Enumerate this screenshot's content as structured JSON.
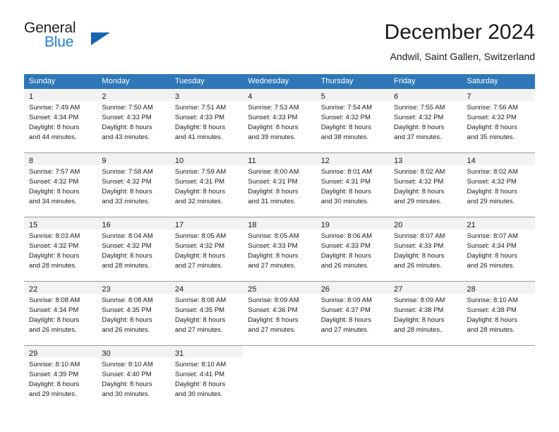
{
  "brand": {
    "name_top": "General",
    "name_bottom": "Blue",
    "triangle_icon": "triangle-icon",
    "color_dark": "#231f20",
    "color_blue": "#1f7fd4"
  },
  "header": {
    "title": "December 2024",
    "subtitle": "Andwil, Saint Gallen, Switzerland"
  },
  "theme": {
    "header_bg": "#2f77b8",
    "header_text": "#ffffff",
    "daynum_band_bg": "#f2f2f2",
    "grid_line": "#9a9a9a",
    "page_bg": "#ffffff"
  },
  "calendar": {
    "weekday_headers": [
      "Sunday",
      "Monday",
      "Tuesday",
      "Wednesday",
      "Thursday",
      "Friday",
      "Saturday"
    ],
    "weeks": [
      [
        {
          "day": "1",
          "sunrise": "Sunrise: 7:49 AM",
          "sunset": "Sunset: 4:34 PM",
          "daylight1": "Daylight: 8 hours",
          "daylight2": "and 44 minutes."
        },
        {
          "day": "2",
          "sunrise": "Sunrise: 7:50 AM",
          "sunset": "Sunset: 4:33 PM",
          "daylight1": "Daylight: 8 hours",
          "daylight2": "and 43 minutes."
        },
        {
          "day": "3",
          "sunrise": "Sunrise: 7:51 AM",
          "sunset": "Sunset: 4:33 PM",
          "daylight1": "Daylight: 8 hours",
          "daylight2": "and 41 minutes."
        },
        {
          "day": "4",
          "sunrise": "Sunrise: 7:53 AM",
          "sunset": "Sunset: 4:33 PM",
          "daylight1": "Daylight: 8 hours",
          "daylight2": "and 39 minutes."
        },
        {
          "day": "5",
          "sunrise": "Sunrise: 7:54 AM",
          "sunset": "Sunset: 4:32 PM",
          "daylight1": "Daylight: 8 hours",
          "daylight2": "and 38 minutes."
        },
        {
          "day": "6",
          "sunrise": "Sunrise: 7:55 AM",
          "sunset": "Sunset: 4:32 PM",
          "daylight1": "Daylight: 8 hours",
          "daylight2": "and 37 minutes."
        },
        {
          "day": "7",
          "sunrise": "Sunrise: 7:56 AM",
          "sunset": "Sunset: 4:32 PM",
          "daylight1": "Daylight: 8 hours",
          "daylight2": "and 35 minutes."
        }
      ],
      [
        {
          "day": "8",
          "sunrise": "Sunrise: 7:57 AM",
          "sunset": "Sunset: 4:32 PM",
          "daylight1": "Daylight: 8 hours",
          "daylight2": "and 34 minutes."
        },
        {
          "day": "9",
          "sunrise": "Sunrise: 7:58 AM",
          "sunset": "Sunset: 4:32 PM",
          "daylight1": "Daylight: 8 hours",
          "daylight2": "and 33 minutes."
        },
        {
          "day": "10",
          "sunrise": "Sunrise: 7:59 AM",
          "sunset": "Sunset: 4:31 PM",
          "daylight1": "Daylight: 8 hours",
          "daylight2": "and 32 minutes."
        },
        {
          "day": "11",
          "sunrise": "Sunrise: 8:00 AM",
          "sunset": "Sunset: 4:31 PM",
          "daylight1": "Daylight: 8 hours",
          "daylight2": "and 31 minutes."
        },
        {
          "day": "12",
          "sunrise": "Sunrise: 8:01 AM",
          "sunset": "Sunset: 4:31 PM",
          "daylight1": "Daylight: 8 hours",
          "daylight2": "and 30 minutes."
        },
        {
          "day": "13",
          "sunrise": "Sunrise: 8:02 AM",
          "sunset": "Sunset: 4:32 PM",
          "daylight1": "Daylight: 8 hours",
          "daylight2": "and 29 minutes."
        },
        {
          "day": "14",
          "sunrise": "Sunrise: 8:02 AM",
          "sunset": "Sunset: 4:32 PM",
          "daylight1": "Daylight: 8 hours",
          "daylight2": "and 29 minutes."
        }
      ],
      [
        {
          "day": "15",
          "sunrise": "Sunrise: 8:03 AM",
          "sunset": "Sunset: 4:32 PM",
          "daylight1": "Daylight: 8 hours",
          "daylight2": "and 28 minutes."
        },
        {
          "day": "16",
          "sunrise": "Sunrise: 8:04 AM",
          "sunset": "Sunset: 4:32 PM",
          "daylight1": "Daylight: 8 hours",
          "daylight2": "and 28 minutes."
        },
        {
          "day": "17",
          "sunrise": "Sunrise: 8:05 AM",
          "sunset": "Sunset: 4:32 PM",
          "daylight1": "Daylight: 8 hours",
          "daylight2": "and 27 minutes."
        },
        {
          "day": "18",
          "sunrise": "Sunrise: 8:05 AM",
          "sunset": "Sunset: 4:33 PM",
          "daylight1": "Daylight: 8 hours",
          "daylight2": "and 27 minutes."
        },
        {
          "day": "19",
          "sunrise": "Sunrise: 8:06 AM",
          "sunset": "Sunset: 4:33 PM",
          "daylight1": "Daylight: 8 hours",
          "daylight2": "and 26 minutes."
        },
        {
          "day": "20",
          "sunrise": "Sunrise: 8:07 AM",
          "sunset": "Sunset: 4:33 PM",
          "daylight1": "Daylight: 8 hours",
          "daylight2": "and 26 minutes."
        },
        {
          "day": "21",
          "sunrise": "Sunrise: 8:07 AM",
          "sunset": "Sunset: 4:34 PM",
          "daylight1": "Daylight: 8 hours",
          "daylight2": "and 26 minutes."
        }
      ],
      [
        {
          "day": "22",
          "sunrise": "Sunrise: 8:08 AM",
          "sunset": "Sunset: 4:34 PM",
          "daylight1": "Daylight: 8 hours",
          "daylight2": "and 26 minutes."
        },
        {
          "day": "23",
          "sunrise": "Sunrise: 8:08 AM",
          "sunset": "Sunset: 4:35 PM",
          "daylight1": "Daylight: 8 hours",
          "daylight2": "and 26 minutes."
        },
        {
          "day": "24",
          "sunrise": "Sunrise: 8:08 AM",
          "sunset": "Sunset: 4:35 PM",
          "daylight1": "Daylight: 8 hours",
          "daylight2": "and 27 minutes."
        },
        {
          "day": "25",
          "sunrise": "Sunrise: 8:09 AM",
          "sunset": "Sunset: 4:36 PM",
          "daylight1": "Daylight: 8 hours",
          "daylight2": "and 27 minutes."
        },
        {
          "day": "26",
          "sunrise": "Sunrise: 8:09 AM",
          "sunset": "Sunset: 4:37 PM",
          "daylight1": "Daylight: 8 hours",
          "daylight2": "and 27 minutes."
        },
        {
          "day": "27",
          "sunrise": "Sunrise: 8:09 AM",
          "sunset": "Sunset: 4:38 PM",
          "daylight1": "Daylight: 8 hours",
          "daylight2": "and 28 minutes."
        },
        {
          "day": "28",
          "sunrise": "Sunrise: 8:10 AM",
          "sunset": "Sunset: 4:38 PM",
          "daylight1": "Daylight: 8 hours",
          "daylight2": "and 28 minutes."
        }
      ],
      [
        {
          "day": "29",
          "sunrise": "Sunrise: 8:10 AM",
          "sunset": "Sunset: 4:39 PM",
          "daylight1": "Daylight: 8 hours",
          "daylight2": "and 29 minutes."
        },
        {
          "day": "30",
          "sunrise": "Sunrise: 8:10 AM",
          "sunset": "Sunset: 4:40 PM",
          "daylight1": "Daylight: 8 hours",
          "daylight2": "and 30 minutes."
        },
        {
          "day": "31",
          "sunrise": "Sunrise: 8:10 AM",
          "sunset": "Sunset: 4:41 PM",
          "daylight1": "Daylight: 8 hours",
          "daylight2": "and 30 minutes."
        },
        {
          "day": "",
          "sunrise": "",
          "sunset": "",
          "daylight1": "",
          "daylight2": ""
        },
        {
          "day": "",
          "sunrise": "",
          "sunset": "",
          "daylight1": "",
          "daylight2": ""
        },
        {
          "day": "",
          "sunrise": "",
          "sunset": "",
          "daylight1": "",
          "daylight2": ""
        },
        {
          "day": "",
          "sunrise": "",
          "sunset": "",
          "daylight1": "",
          "daylight2": ""
        }
      ]
    ]
  }
}
